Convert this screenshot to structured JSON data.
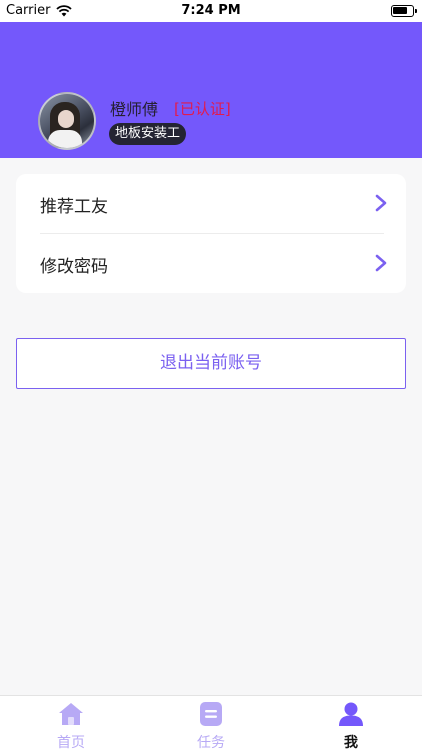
{
  "status_bar": {
    "carrier": "Carrier",
    "time": "7:24 PM"
  },
  "profile": {
    "name": "橙师傅",
    "verified_label": "[已认证]",
    "role_tag": "地板安装工"
  },
  "menu": {
    "items": [
      {
        "label": "推荐工友",
        "icon": "chevron-right-icon"
      },
      {
        "label": "修改密码",
        "icon": "chevron-right-icon"
      }
    ]
  },
  "logout": {
    "label": "退出当前账号"
  },
  "tab_bar": {
    "tabs": [
      {
        "label": "首页",
        "icon": "home-icon",
        "active": false
      },
      {
        "label": "任务",
        "icon": "task-icon",
        "active": false
      },
      {
        "label": "我",
        "icon": "profile-icon",
        "active": true
      }
    ]
  },
  "colors": {
    "header_bg": "#7458fb",
    "accent": "#7b61f0",
    "verified": "#e11b4e",
    "tab_inactive": "#b7a9f5"
  }
}
